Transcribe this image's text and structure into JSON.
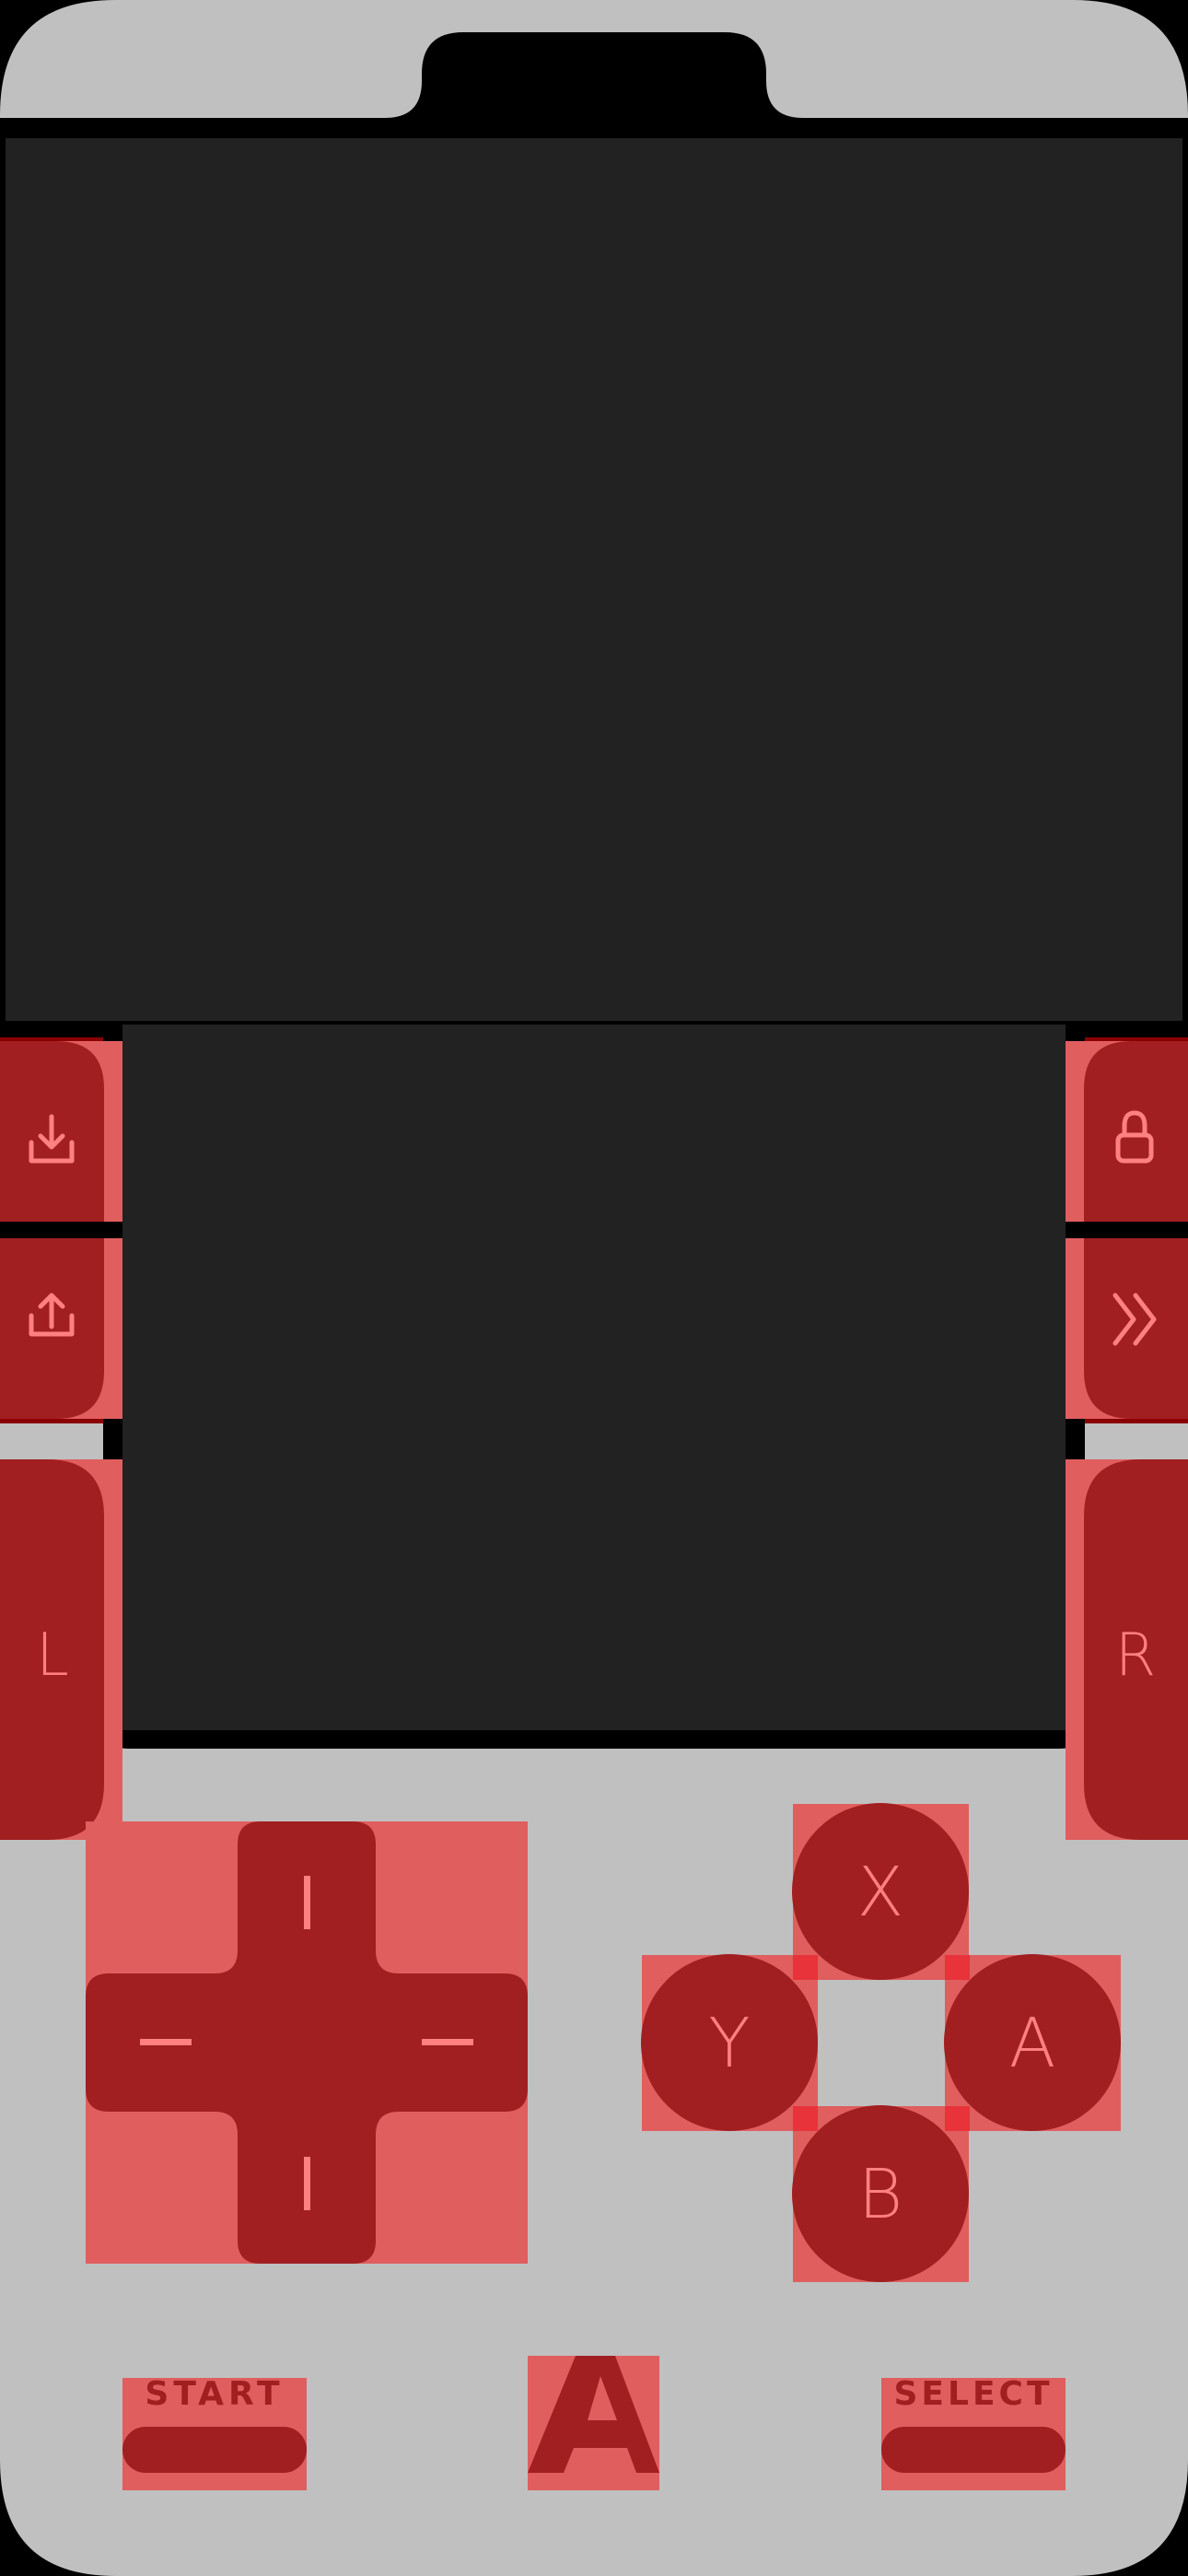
{
  "theme": {
    "body": "#c0c0c0",
    "frame": "#000000",
    "screen": "#222222",
    "button": "#a11e21",
    "button_dark": "#8b0000",
    "hitbox": "#e05e5e",
    "hitbox_corner": "#e8333a",
    "glyph": "#ff8080"
  },
  "side_buttons": {
    "left_top_icon": "download-tray-icon",
    "left_mid_icon": "upload-tray-icon",
    "left_shoulder_label": "L",
    "right_top_icon": "padlock-icon",
    "right_mid_icon": "fast-forward-chevrons-icon",
    "right_shoulder_label": "R"
  },
  "dpad": {
    "up_icon": "vertical-bar-icon",
    "down_icon": "vertical-bar-icon",
    "left_icon": "horizontal-bar-icon",
    "right_icon": "horizontal-bar-icon"
  },
  "face_buttons": {
    "x_label": "X",
    "y_label": "Y",
    "a_label": "A",
    "b_label": "B"
  },
  "bottom": {
    "start_label": "START",
    "select_label": "SELECT",
    "menu_icon": "delta-a-logo-icon"
  }
}
